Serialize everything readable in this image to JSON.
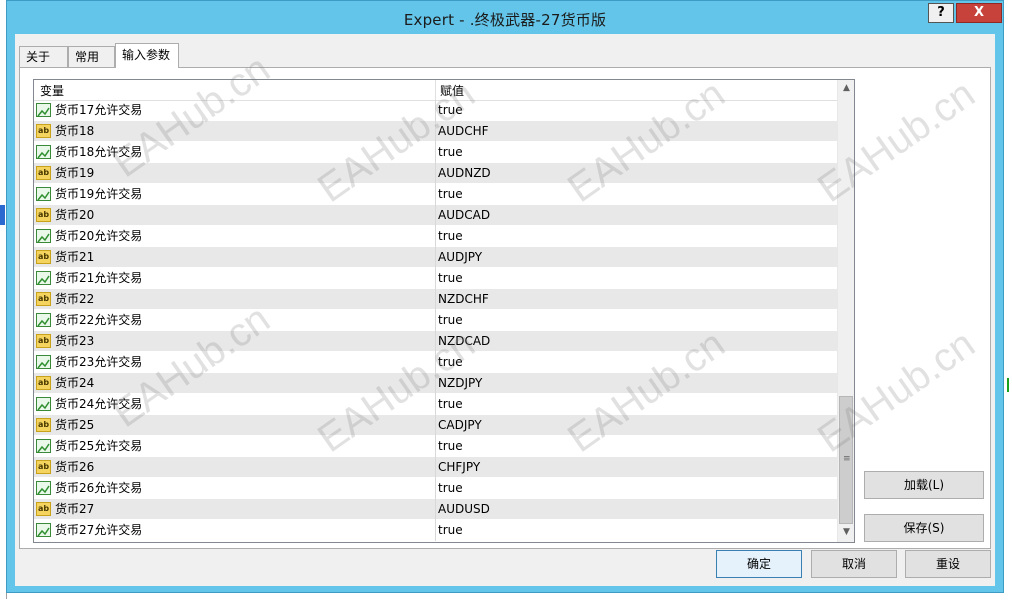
{
  "window": {
    "title": "Expert - .终极武器-27货币版",
    "help_label": "?",
    "close_label": "X"
  },
  "tabs": [
    {
      "label": "关于"
    },
    {
      "label": "常用"
    },
    {
      "label": "输入参数"
    }
  ],
  "grid": {
    "headers": {
      "variable": "变量",
      "value": "赋值"
    },
    "rows": [
      {
        "type": "bool",
        "name": "货币17允许交易",
        "value": "true"
      },
      {
        "type": "str",
        "name": "货币18",
        "value": "AUDCHF"
      },
      {
        "type": "bool",
        "name": "货币18允许交易",
        "value": "true"
      },
      {
        "type": "str",
        "name": "货币19",
        "value": "AUDNZD"
      },
      {
        "type": "bool",
        "name": "货币19允许交易",
        "value": "true"
      },
      {
        "type": "str",
        "name": "货币20",
        "value": "AUDCAD"
      },
      {
        "type": "bool",
        "name": "货币20允许交易",
        "value": "true"
      },
      {
        "type": "str",
        "name": "货币21",
        "value": "AUDJPY"
      },
      {
        "type": "bool",
        "name": "货币21允许交易",
        "value": "true"
      },
      {
        "type": "str",
        "name": "货币22",
        "value": "NZDCHF"
      },
      {
        "type": "bool",
        "name": "货币22允许交易",
        "value": "true"
      },
      {
        "type": "str",
        "name": "货币23",
        "value": "NZDCAD"
      },
      {
        "type": "bool",
        "name": "货币23允许交易",
        "value": "true"
      },
      {
        "type": "str",
        "name": "货币24",
        "value": "NZDJPY"
      },
      {
        "type": "bool",
        "name": "货币24允许交易",
        "value": "true"
      },
      {
        "type": "str",
        "name": "货币25",
        "value": "CADJPY"
      },
      {
        "type": "bool",
        "name": "货币25允许交易",
        "value": "true"
      },
      {
        "type": "str",
        "name": "货币26",
        "value": "CHFJPY"
      },
      {
        "type": "bool",
        "name": "货币26允许交易",
        "value": "true"
      },
      {
        "type": "str",
        "name": "货币27",
        "value": "AUDUSD"
      },
      {
        "type": "bool",
        "name": "货币27允许交易",
        "value": "true"
      }
    ],
    "icon_labels": {
      "str": "ab"
    }
  },
  "buttons": {
    "load": "加载(L)",
    "save": "保存(S)",
    "ok": "确定",
    "cancel": "取消",
    "reset": "重设"
  },
  "watermark": {
    "text": "EAHub.cn"
  },
  "colors": {
    "title_bar": "#63c5e9",
    "close_button": "#c7423b",
    "row_alt": "#e8e8e8"
  }
}
